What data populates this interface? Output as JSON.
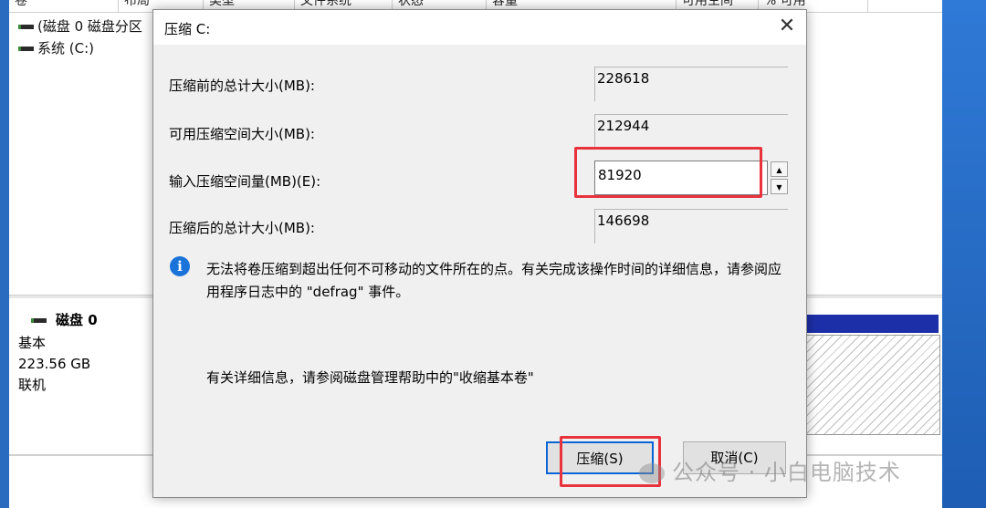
{
  "background": {
    "columns": [
      "卷",
      "布局",
      "类型",
      "文件系统",
      "状态",
      "容量",
      "可用空间",
      "% 可用"
    ],
    "volumes": [
      "(磁盘 0 磁盘分区",
      "系统 (C:)"
    ],
    "disk": {
      "name": "磁盘 0",
      "type": "基本",
      "size": "223.56 GB",
      "status": "联机"
    }
  },
  "dialog": {
    "title": "压缩 C:",
    "fields": {
      "total_before_label": "压缩前的总计大小(MB):",
      "total_before_value": "228618",
      "available_label": "可用压缩空间大小(MB):",
      "available_value": "212944",
      "input_label": "输入压缩空间量(MB)(E):",
      "input_value": "81920",
      "total_after_label": "压缩后的总计大小(MB):",
      "total_after_value": "146698"
    },
    "info_text": "无法将卷压缩到超出任何不可移动的文件所在的点。有关完成该操作时间的详细信息，请参阅应用程序日志中的 \"defrag\" 事件。",
    "help_text": "有关详细信息，请参阅磁盘管理帮助中的\"收缩基本卷\"",
    "buttons": {
      "ok": "压缩(S)",
      "cancel": "取消(C)"
    }
  },
  "watermark": "公众号 · 小白电脑技术",
  "colors": {
    "highlight": "#e8323c",
    "info": "#1a73d9",
    "partition": "#1c2fa8"
  }
}
